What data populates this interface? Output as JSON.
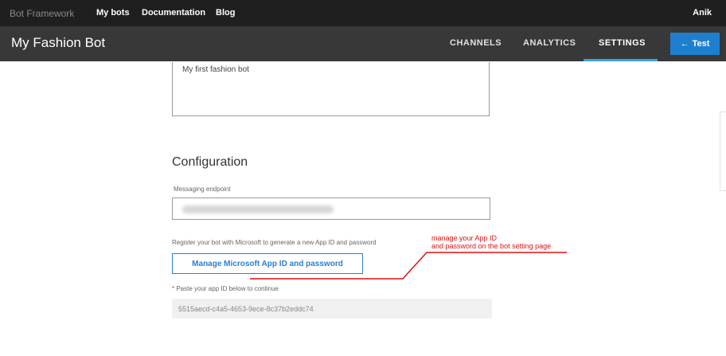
{
  "topbar": {
    "brand": "Bot Framework",
    "nav": [
      "My bots",
      "Documentation",
      "Blog"
    ],
    "user": "Anik"
  },
  "header": {
    "title": "My Fashion Bot",
    "tabs": [
      "CHANNELS",
      "ANALYTICS",
      "SETTINGS"
    ],
    "active_tab": "SETTINGS",
    "test_label": "Test",
    "test_icon": "left-arrow-icon"
  },
  "form": {
    "description_value": "My first fashion bot",
    "section_title": "Configuration",
    "endpoint_label": "Messaging endpoint",
    "register_text": "Register your bot with Microsoft to generate a new App ID and password",
    "manage_button": "Manage Microsoft App ID and password",
    "paste_text": "* Paste your app ID below to continue",
    "app_id_value": "5515aecd-c4a5-4653-9ece-8c37b2eddc74"
  },
  "annotation": {
    "line1": "manage your App ID",
    "line2": "and password on the bot setting page",
    "color": "#dd1111"
  },
  "colors": {
    "accent": "#1e7fd0",
    "topbar": "#1f1f1f",
    "header": "#383838"
  }
}
